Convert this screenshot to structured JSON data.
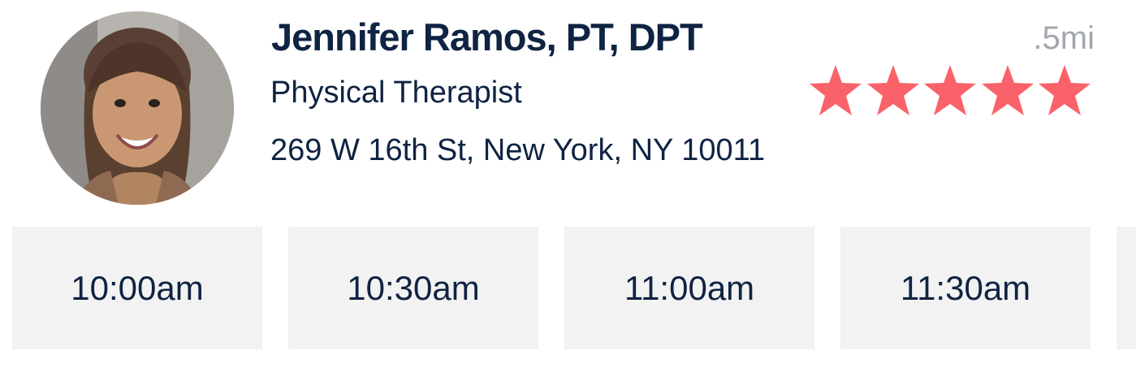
{
  "provider": {
    "name": "Jennifer Ramos, PT, DPT",
    "title": "Physical Therapist",
    "address": "269 W 16th St, New York, NY 10011",
    "distance": ".5mi",
    "rating": 5,
    "rating_max": 5
  },
  "appointment_slots": [
    {
      "time": "10:00am"
    },
    {
      "time": "10:30am"
    },
    {
      "time": "11:00am"
    },
    {
      "time": "11:30am"
    },
    {
      "time": ""
    }
  ],
  "colors": {
    "text": "#0f2342",
    "muted": "#a3a7ae",
    "star": "#fa626a",
    "slot_bg": "#f2f2f2"
  },
  "icons": {
    "rating": "star-icon",
    "avatar": "provider-photo"
  }
}
